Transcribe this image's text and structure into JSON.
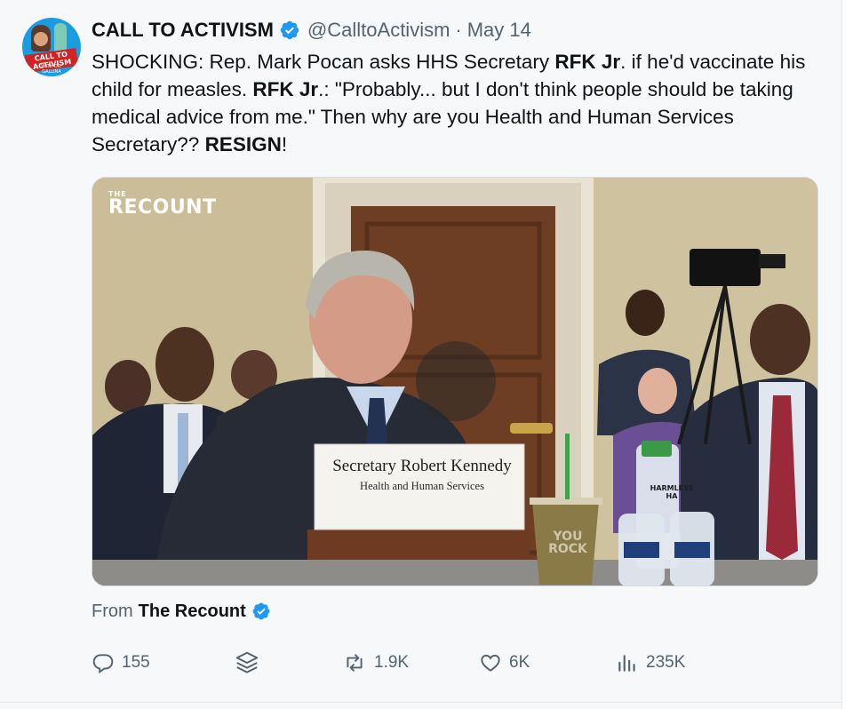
{
  "tweet": {
    "author": {
      "display_name": "CALL TO ACTIVISM",
      "handle": "@CalltoActivism",
      "avatar_text": "CALL TO ACTIVISM",
      "avatar_subtext": "WITH DR. GALLINA"
    },
    "separator": "·",
    "date": "May 14",
    "text": {
      "s1": "SHOCKING: Rep. Mark Pocan asks HHS Secretary ",
      "b1": "RFK Jr",
      "s2": ". if he'd vaccinate his child for measles. ",
      "b2": "RFK Jr",
      "s3": ".: \"Probably... but I don't think people should be taking medical advice from me.\" Then why are you Health and Human Services Secretary?? ",
      "b3": "RESIGN",
      "s4": "!"
    },
    "media": {
      "watermark_small": "THE",
      "watermark_name": "RECOUNT",
      "placard_title": "Secretary Robert Kennedy",
      "placard_subtitle": "Health and Human Services",
      "cup_text": "YOU ROCK",
      "bottle_text": "HARMLESS HA"
    },
    "attribution": {
      "label": "From",
      "source": "The Recount"
    },
    "actions": {
      "replies": "155",
      "retweets": "1.9K",
      "likes": "6K",
      "views": "235K"
    }
  },
  "colors": {
    "verified_blue": "#1d9bf0",
    "text_primary": "#0f1419",
    "text_secondary": "#536471",
    "background": "#f7f8f9"
  },
  "icons": [
    "reply-icon",
    "bookmark-stack-icon",
    "retweet-icon",
    "like-icon",
    "views-icon",
    "verified-icon",
    "play-icon"
  ]
}
